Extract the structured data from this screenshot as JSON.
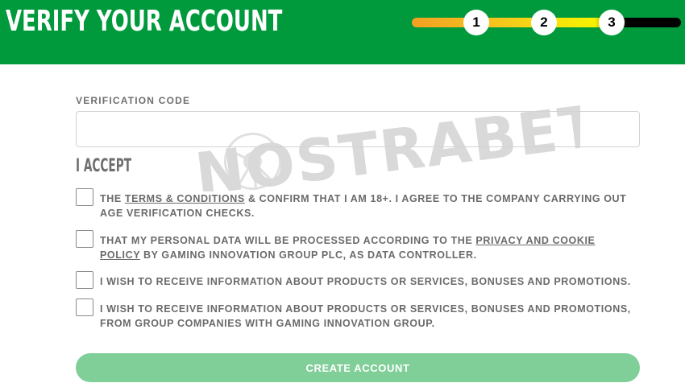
{
  "header": {
    "title": "VERIFY YOUR ACCOUNT",
    "steps": [
      "1",
      "2",
      "3"
    ]
  },
  "watermark": {
    "text": "NOSTRABET"
  },
  "form": {
    "verification_label": "VERIFICATION CODE",
    "verification_value": "",
    "accept_heading": "I ACCEPT",
    "checkboxes": [
      {
        "prefix": "THE ",
        "link": "TERMS & CONDITIONS",
        "suffix": " & CONFIRM THAT I AM 18+. I AGREE TO THE COMPANY CARRYING OUT AGE VERIFICATION CHECKS.",
        "checked": false
      },
      {
        "prefix": "THAT MY PERSONAL DATA WILL BE PROCESSED ACCORDING TO THE ",
        "link": "PRIVACY AND COOKIE POLICY",
        "suffix": " BY GAMING INNOVATION GROUP PLC, AS DATA CONTROLLER.",
        "checked": false
      },
      {
        "text": "I WISH TO RECEIVE INFORMATION ABOUT PRODUCTS OR SERVICES, BONUSES AND PROMOTIONS.",
        "checked": false
      },
      {
        "text": "I WISH TO RECEIVE INFORMATION ABOUT PRODUCTS OR SERVICES, BONUSES AND PROMOTIONS, FROM GROUP COMPANIES WITH GAMING INNOVATION GROUP.",
        "checked": false
      }
    ],
    "submit_label": "CREATE ACCOUNT"
  },
  "colors": {
    "header_green": "#009a3c",
    "button_green": "#80cf98",
    "text_gray": "#6a6a6a",
    "progress_orange": "#f2a024",
    "progress_yellow": "#f7f200",
    "progress_black": "#000000"
  }
}
